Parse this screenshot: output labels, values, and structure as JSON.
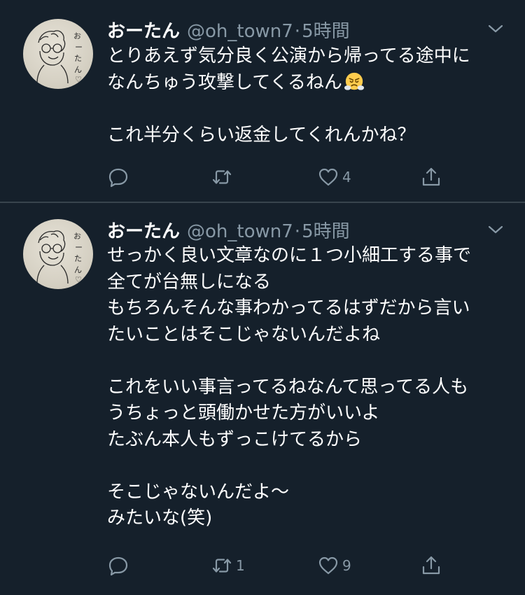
{
  "tweets": [
    {
      "author": {
        "name": "おーたん",
        "handle": "@oh_town7",
        "avatar_text": "おーたん"
      },
      "separator": "·",
      "time": "5時間",
      "lines": [
        "とりあえず気分良く公演から帰ってる途中に",
        "なんちゅう攻撃してくるねん",
        "",
        "これ半分くらい返金してくれんかね？"
      ],
      "emoji_after_line": 1,
      "emoji": "face-with-steam-from-nose",
      "counts": {
        "reply": "",
        "retweet": "",
        "like": "4"
      }
    },
    {
      "author": {
        "name": "おーたん",
        "handle": "@oh_town7",
        "avatar_text": "おーたん"
      },
      "separator": "·",
      "time": "5時間",
      "lines": [
        "せっかく良い文章なのに１つ小細工する事で",
        "全てが台無しになる",
        "もちろんそんな事わかってるはずだから言い",
        "たいことはそこじゃないんだよね",
        "",
        "これをいい事言ってるねなんて思ってる人も",
        "うちょっと頭働かせた方がいいよ",
        "たぶん本人もずっこけてるから",
        "",
        "そこじゃないんだよ〜",
        "みたいな(笑)"
      ],
      "counts": {
        "reply": "",
        "retweet": "1",
        "like": "9"
      }
    }
  ],
  "colors": {
    "background": "#15202b",
    "text": "#ffffff",
    "muted": "#8899a6",
    "divider": "#38444d"
  },
  "icons": [
    "reply-icon",
    "retweet-icon",
    "like-icon",
    "share-icon",
    "chevron-down-icon"
  ]
}
